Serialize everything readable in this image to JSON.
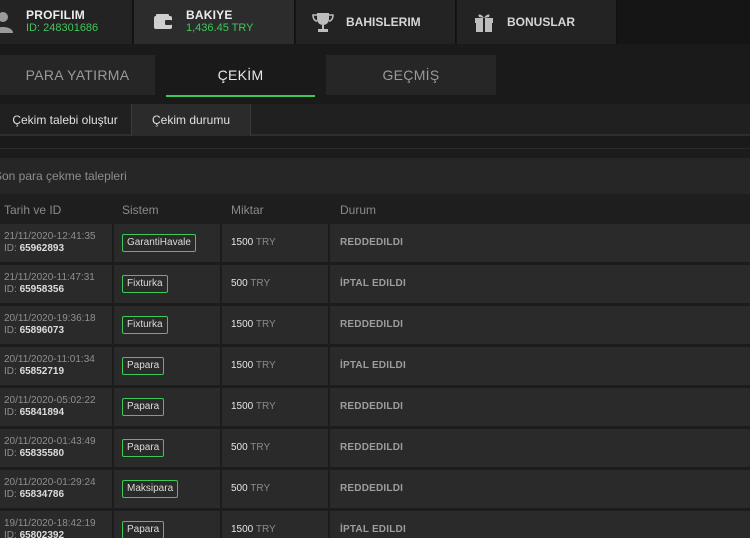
{
  "topnav": {
    "profile": {
      "label": "PROFILIM",
      "sub": "ID: 248301686",
      "icon": "user-icon"
    },
    "balance": {
      "label": "BAKIYE",
      "sub": "1,436.45 TRY",
      "icon": "wallet-icon"
    },
    "bets": {
      "label": "BAHISLERIM",
      "icon": "trophy-icon"
    },
    "bonuses": {
      "label": "BONUSLAR",
      "icon": "gift-icon"
    }
  },
  "subnav": {
    "deposit": "PARA YATIRMA",
    "withdraw": "ÇEKİM",
    "history": "GEÇMİŞ"
  },
  "innernav": {
    "create": "Çekim talebi oluştur",
    "status": "Çekim durumu"
  },
  "section_title": "Son para çekme talepleri",
  "table": {
    "headers": {
      "date": "Tarih ve ID",
      "system": "Sistem",
      "amount": "Miktar",
      "status": "Durum"
    },
    "id_prefix": "ID:",
    "rows": [
      {
        "date": "21/11/2020-12:41:35",
        "id": "65962893",
        "system": "GarantiHavale",
        "amount": "1500",
        "currency": "TRY",
        "status": "REDDEDILDI"
      },
      {
        "date": "21/11/2020-11:47:31",
        "id": "65958356",
        "system": "Fixturka",
        "amount": "500",
        "currency": "TRY",
        "status": "İPTAL EDILDI"
      },
      {
        "date": "20/11/2020-19:36:18",
        "id": "65896073",
        "system": "Fixturka",
        "amount": "1500",
        "currency": "TRY",
        "status": "REDDEDILDI"
      },
      {
        "date": "20/11/2020-11:01:34",
        "id": "65852719",
        "system": "Papara",
        "amount": "1500",
        "currency": "TRY",
        "status": "İPTAL EDILDI"
      },
      {
        "date": "20/11/2020-05:02:22",
        "id": "65841894",
        "system": "Papara",
        "amount": "1500",
        "currency": "TRY",
        "status": "REDDEDILDI"
      },
      {
        "date": "20/11/2020-01:43:49",
        "id": "65835580",
        "system": "Papara",
        "amount": "500",
        "currency": "TRY",
        "status": "REDDEDILDI"
      },
      {
        "date": "20/11/2020-01:29:24",
        "id": "65834786",
        "system": "Maksipara",
        "amount": "500",
        "currency": "TRY",
        "status": "REDDEDILDI"
      },
      {
        "date": "19/11/2020-18:42:19",
        "id": "65802392",
        "system": "Papara",
        "amount": "1500",
        "currency": "TRY",
        "status": "İPTAL EDILDI"
      }
    ]
  },
  "colors": {
    "accent": "#3ec85a",
    "bg": "#1c1c1c"
  }
}
